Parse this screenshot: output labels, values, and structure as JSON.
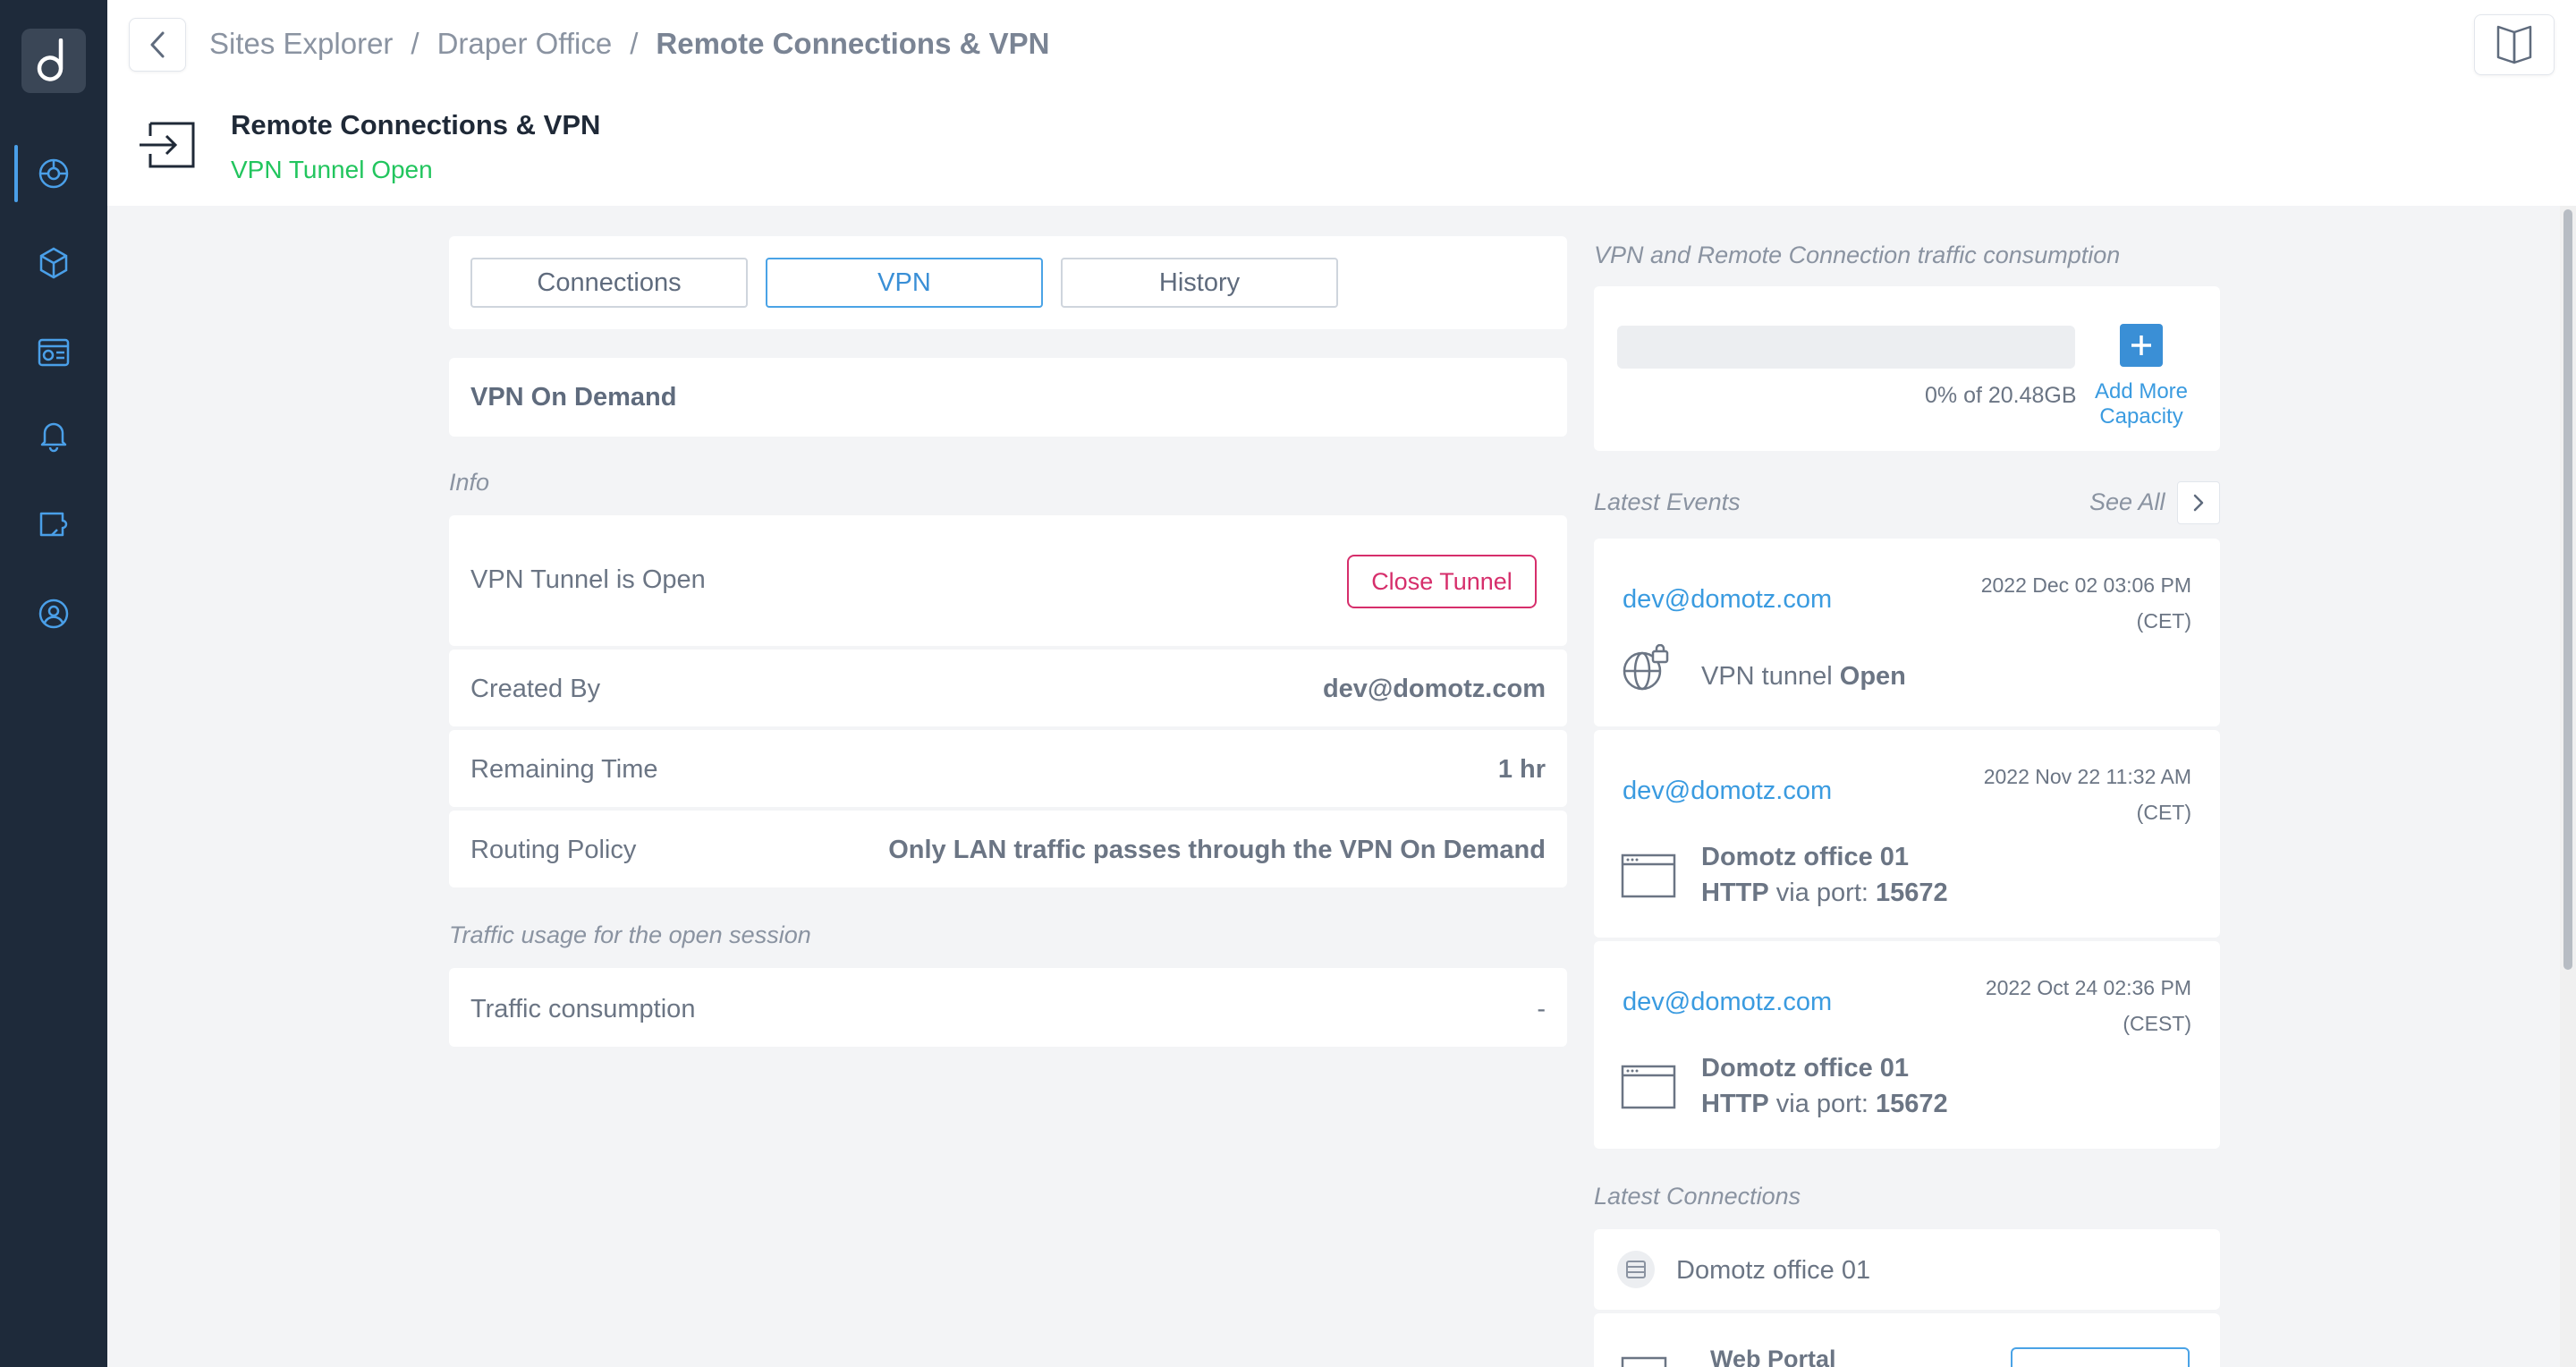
{
  "breadcrumb": {
    "items": [
      "Sites Explorer",
      "Draper Office"
    ],
    "separator": "/",
    "current": "Remote Connections & VPN"
  },
  "header": {
    "title": "Remote Connections & VPN",
    "status": "VPN Tunnel Open",
    "status_color": "#22c55e"
  },
  "tabs": [
    {
      "label": "Connections",
      "active": false
    },
    {
      "label": "VPN",
      "active": true
    },
    {
      "label": "History",
      "active": false
    }
  ],
  "vpn_section": {
    "title": "VPN On Demand",
    "info_label": "Info",
    "tunnel_status": "VPN Tunnel is Open",
    "close_button": "Close Tunnel",
    "rows": [
      {
        "label": "Created By",
        "value": "dev@domotz.com"
      },
      {
        "label": "Remaining Time",
        "value": "1 hr"
      },
      {
        "label": "Routing Policy",
        "value": "Only LAN traffic passes through the VPN On Demand"
      }
    ],
    "traffic_label": "Traffic usage for the open session",
    "traffic_row": {
      "label": "Traffic consumption",
      "value": "-"
    }
  },
  "traffic_panel": {
    "title": "VPN and Remote Connection traffic consumption",
    "usage_fraction": 0,
    "usage_text": "0% of 20.48GB",
    "add_label_1": "Add More",
    "add_label_2": "Capacity"
  },
  "events": {
    "title": "Latest Events",
    "see_all": "See All",
    "items": [
      {
        "email": "dev@domotz.com",
        "date": "2022 Dec 02 03:06 PM",
        "tz": "(CET)",
        "icon": "globe-lock-icon",
        "line1_prefix": "VPN tunnel",
        "line1_bold": "Open"
      },
      {
        "email": "dev@domotz.com",
        "date": "2022 Nov 22 11:32 AM",
        "tz": "(CET)",
        "icon": "browser-window-icon",
        "line1_bold": "Domotz office 01",
        "line2_bold1": "HTTP",
        "line2_mid": "via port:",
        "line2_bold2": "15672"
      },
      {
        "email": "dev@domotz.com",
        "date": "2022 Oct 24 02:36 PM",
        "tz": "(CEST)",
        "icon": "browser-window-icon",
        "line1_bold": "Domotz office 01",
        "line2_bold1": "HTTP",
        "line2_mid": "via port:",
        "line2_bold2": "15672"
      }
    ]
  },
  "connections": {
    "title": "Latest Connections",
    "device": "Domotz office 01",
    "item": "Web Portal"
  },
  "colors": {
    "sidebar": "#1e2a3a",
    "accent": "#4a9fe8",
    "danger": "#d62e6b",
    "link": "#3a9be0"
  }
}
